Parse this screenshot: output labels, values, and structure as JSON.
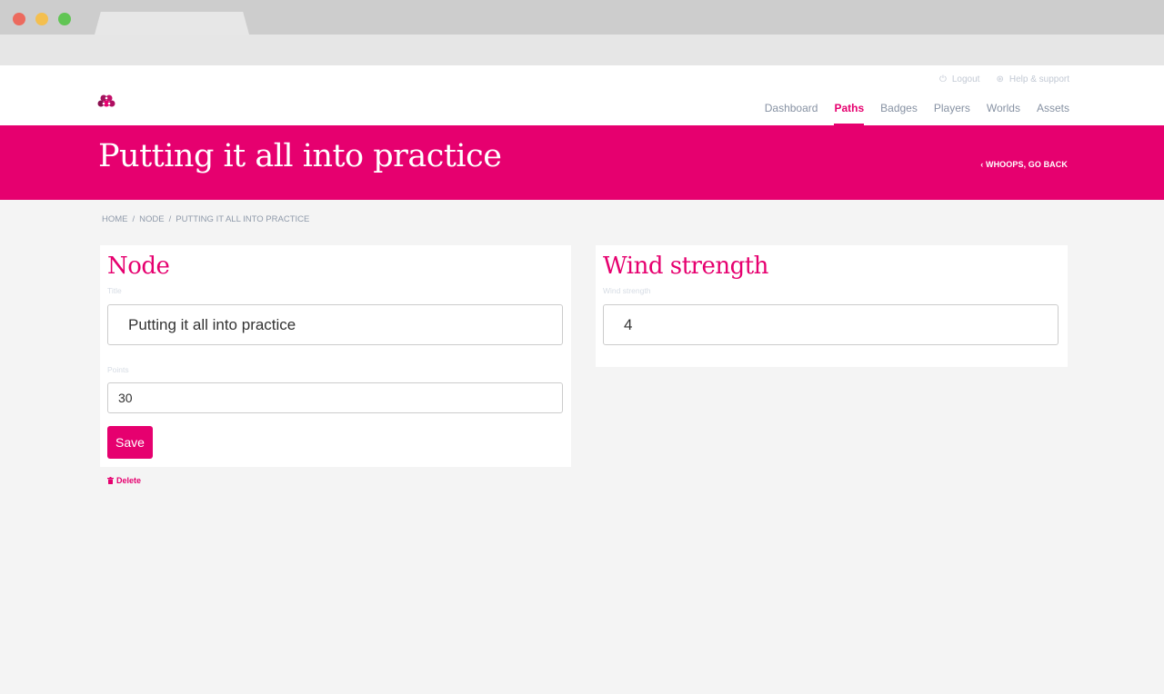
{
  "header": {
    "util_links": [
      {
        "label": "Logout",
        "icon": "power-icon"
      },
      {
        "label": "Help & support",
        "icon": "lifebuoy-icon"
      }
    ],
    "nav": [
      {
        "label": "Dashboard",
        "active": false
      },
      {
        "label": "Paths",
        "active": true
      },
      {
        "label": "Badges",
        "active": false
      },
      {
        "label": "Players",
        "active": false
      },
      {
        "label": "Worlds",
        "active": false
      },
      {
        "label": "Assets",
        "active": false
      }
    ]
  },
  "banner": {
    "title": "Putting it all into practice",
    "back_label": "WHOOPS, GO BACK"
  },
  "breadcrumb": [
    "HOME",
    "NODE",
    "PUTTING IT ALL INTO PRACTICE"
  ],
  "node_card": {
    "title": "Node",
    "title_label": "Title",
    "title_value": "Putting it all into practice",
    "points_label": "Points",
    "points_value": "30",
    "save_label": "Save"
  },
  "wind_card": {
    "title": "Wind strength",
    "label": "Wind strength",
    "value": "4"
  },
  "delete_label": "Delete",
  "colors": {
    "accent": "#e6006f",
    "background": "#f4f4f4"
  }
}
